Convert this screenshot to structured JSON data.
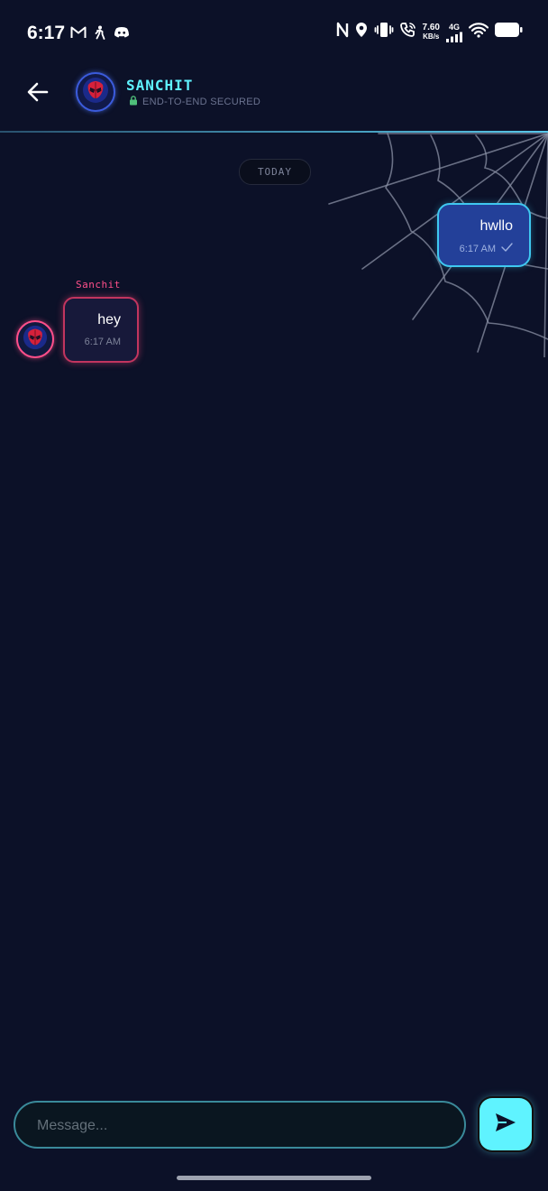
{
  "status_bar": {
    "time": "6:17",
    "net_speed_value": "7.60",
    "net_speed_unit": "KB/s",
    "network_type": "4G",
    "left_icons": [
      "gmail-icon",
      "accessibility-icon",
      "discord-icon"
    ],
    "right_icons": [
      "nfc-icon",
      "location-icon",
      "vibrate-icon",
      "wifi-calling-icon",
      "cell-signal-icon",
      "wifi-icon",
      "battery-icon"
    ]
  },
  "header": {
    "contact_name": "SANCHIT",
    "security_label": "END-TO-END SECURED",
    "back_icon": "arrow-left-icon",
    "avatar_icon": "spiderman-mask-icon"
  },
  "chat": {
    "date_divider": "TODAY",
    "messages": [
      {
        "direction": "outgoing",
        "text": "hwllo",
        "time": "6:17 AM",
        "status_icon": "check-icon"
      },
      {
        "direction": "incoming",
        "sender": "Sanchit",
        "text": "hey",
        "time": "6:17 AM"
      }
    ]
  },
  "composer": {
    "placeholder": "Message...",
    "value": "",
    "send_icon": "send-icon"
  },
  "colors": {
    "background": "#0c1128",
    "accent_cyan": "#5ff3ff",
    "accent_pink": "#ff4f8a",
    "outgoing_bubble": "#234099",
    "incoming_bubble": "#17193a"
  }
}
